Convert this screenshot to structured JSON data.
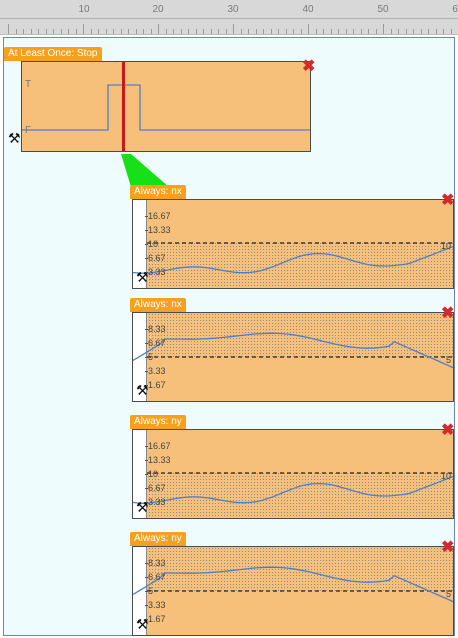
{
  "ruler": {
    "ticks": [
      "10",
      "20",
      "30",
      "40",
      "50",
      "6"
    ]
  },
  "top_block": {
    "label": "At Least Once: Stop",
    "true_label": "T",
    "false_label": "F"
  },
  "sub_blocks": [
    {
      "label": "Always: nx",
      "y_ticks": [
        "16.67",
        "13.33",
        "10",
        "6.67",
        "3.33"
      ],
      "threshold": "10"
    },
    {
      "label": "Always: nx",
      "y_ticks": [
        "8.33",
        "6.67",
        "5",
        "3.33",
        "1.67"
      ],
      "threshold": "5"
    },
    {
      "label": "Always: ny",
      "y_ticks": [
        "16.67",
        "13.33",
        "10",
        "6.67",
        "3.33"
      ],
      "threshold": "10"
    },
    {
      "label": "Always: ny",
      "y_ticks": [
        "8.33",
        "6.67",
        "5",
        "3.33",
        "1.67"
      ],
      "threshold": "5"
    }
  ],
  "icons": {
    "close": "close-icon",
    "tools": "tools-icon"
  },
  "colors": {
    "block_fill": "#f6c07a",
    "label_fill": "#f6a11e",
    "close": "#d62a2a",
    "signal": "#4a7fd0",
    "cursor": "#c41a1a",
    "connector": "#18e018"
  }
}
